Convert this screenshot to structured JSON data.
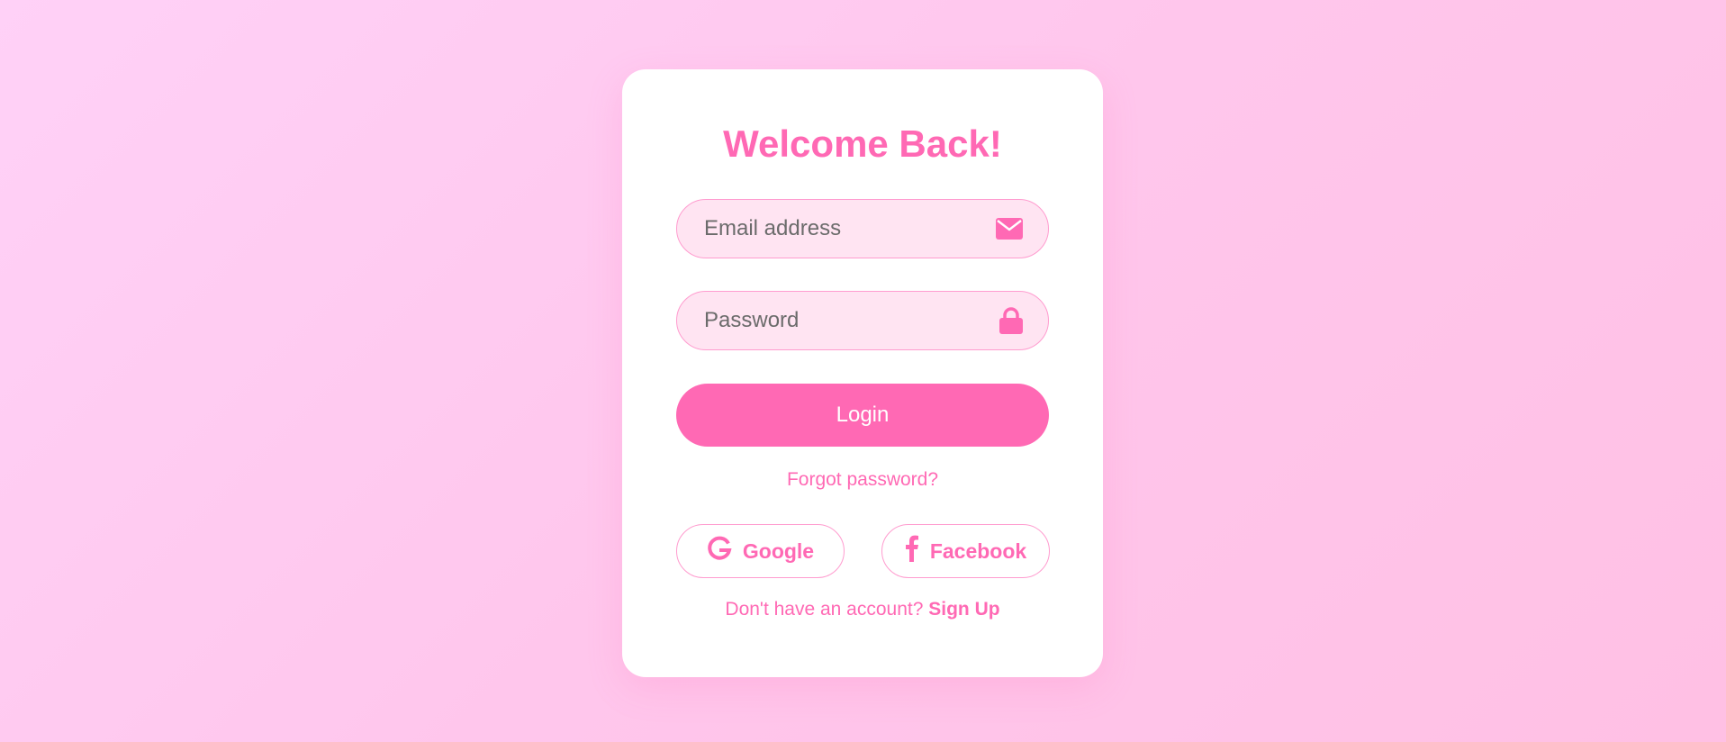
{
  "colors": {
    "accent": "#ff69b4",
    "input_bg": "#ffe4f2",
    "card_bg": "#ffffff",
    "page_bg": "#ffc6ec"
  },
  "login_card": {
    "title": "Welcome Back!",
    "email": {
      "placeholder": "Email address",
      "value": "",
      "icon": "envelope-icon"
    },
    "password": {
      "placeholder": "Password",
      "value": "",
      "icon": "lock-icon"
    },
    "login_label": "Login",
    "forgot_label": "Forgot password?",
    "social": [
      {
        "label": "Google",
        "icon": "google-icon"
      },
      {
        "label": "Facebook",
        "icon": "facebook-icon"
      }
    ],
    "signup_prompt": "Don't have an account?",
    "signup_link": "Sign Up"
  }
}
